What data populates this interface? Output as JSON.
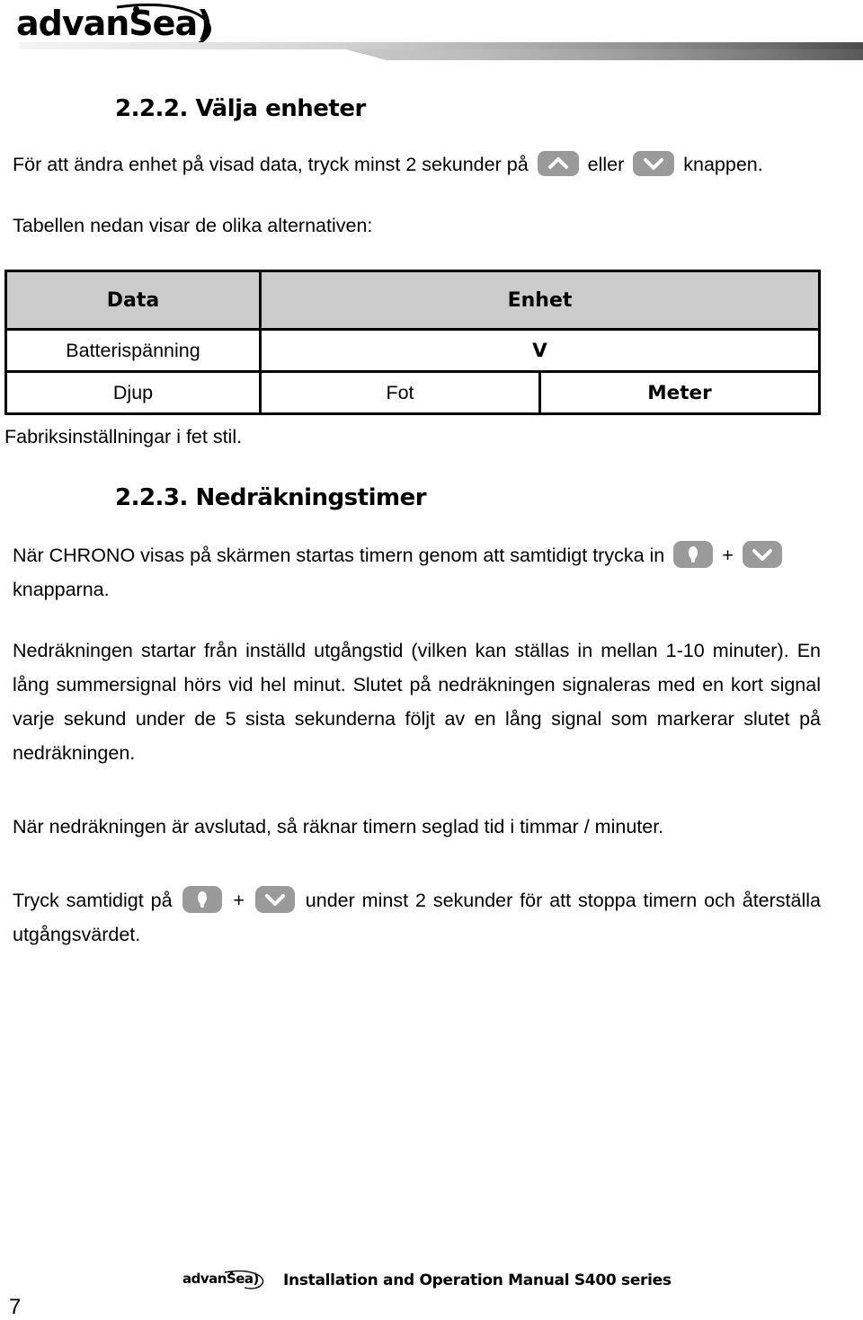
{
  "header": {
    "logo_text": "advanSea",
    "logo_paren": ")"
  },
  "sections": {
    "s1": {
      "heading": "2.2.2. Välja enheter",
      "para_1a": "För att ändra enhet på visad data, tryck minst 2 sekunder på",
      "para_1b": "eller",
      "para_1c": "knappen.",
      "para_2": "Tabellen nedan visar de olika alternativen:",
      "note": "Fabriksinställningar i fet stil."
    },
    "s2": {
      "heading": "2.2.3. Nedräkningstimer",
      "para_1a": "När CHRONO visas på skärmen startas timern genom att samtidigt trycka in",
      "para_1b": "+",
      "para_1c": "knapparna.",
      "para_2": "Nedräkningen startar från inställd utgångstid (vilken kan ställas in mellan 1-10 minuter). En lång summersignal hörs vid hel minut. Slutet på nedräkningen signaleras med en kort signal varje sekund under de 5 sista sekunderna följt av en lång signal som markerar slutet på nedräkningen.",
      "para_3": "När nedräkningen är avslutad, så räknar timern seglad tid i timmar / minuter.",
      "para_4a": "Tryck samtidigt på",
      "para_4b": "+",
      "para_4c": "under minst 2 sekunder för att stoppa timern och återställa utgångsvärdet."
    }
  },
  "table": {
    "headers": [
      "Data",
      "Enhet"
    ],
    "rows": [
      {
        "data": "Batterispänning",
        "values": [
          "V"
        ],
        "bold": [
          true
        ]
      },
      {
        "data": "Djup",
        "values": [
          "Fot",
          "Meter"
        ],
        "bold": [
          false,
          true
        ]
      }
    ]
  },
  "icons": {
    "up_key": "chevron-up-key",
    "down_key": "chevron-down-key",
    "light_key": "light-bulb-key"
  },
  "colors": {
    "key_gray": "#9a9a9a",
    "table_header_gray": "#cccccc",
    "text": "#000000"
  },
  "footer": {
    "logo_text": "advanSea",
    "logo_paren": ")",
    "title": "Installation and Operation Manual S400 series",
    "page_number": "7"
  }
}
